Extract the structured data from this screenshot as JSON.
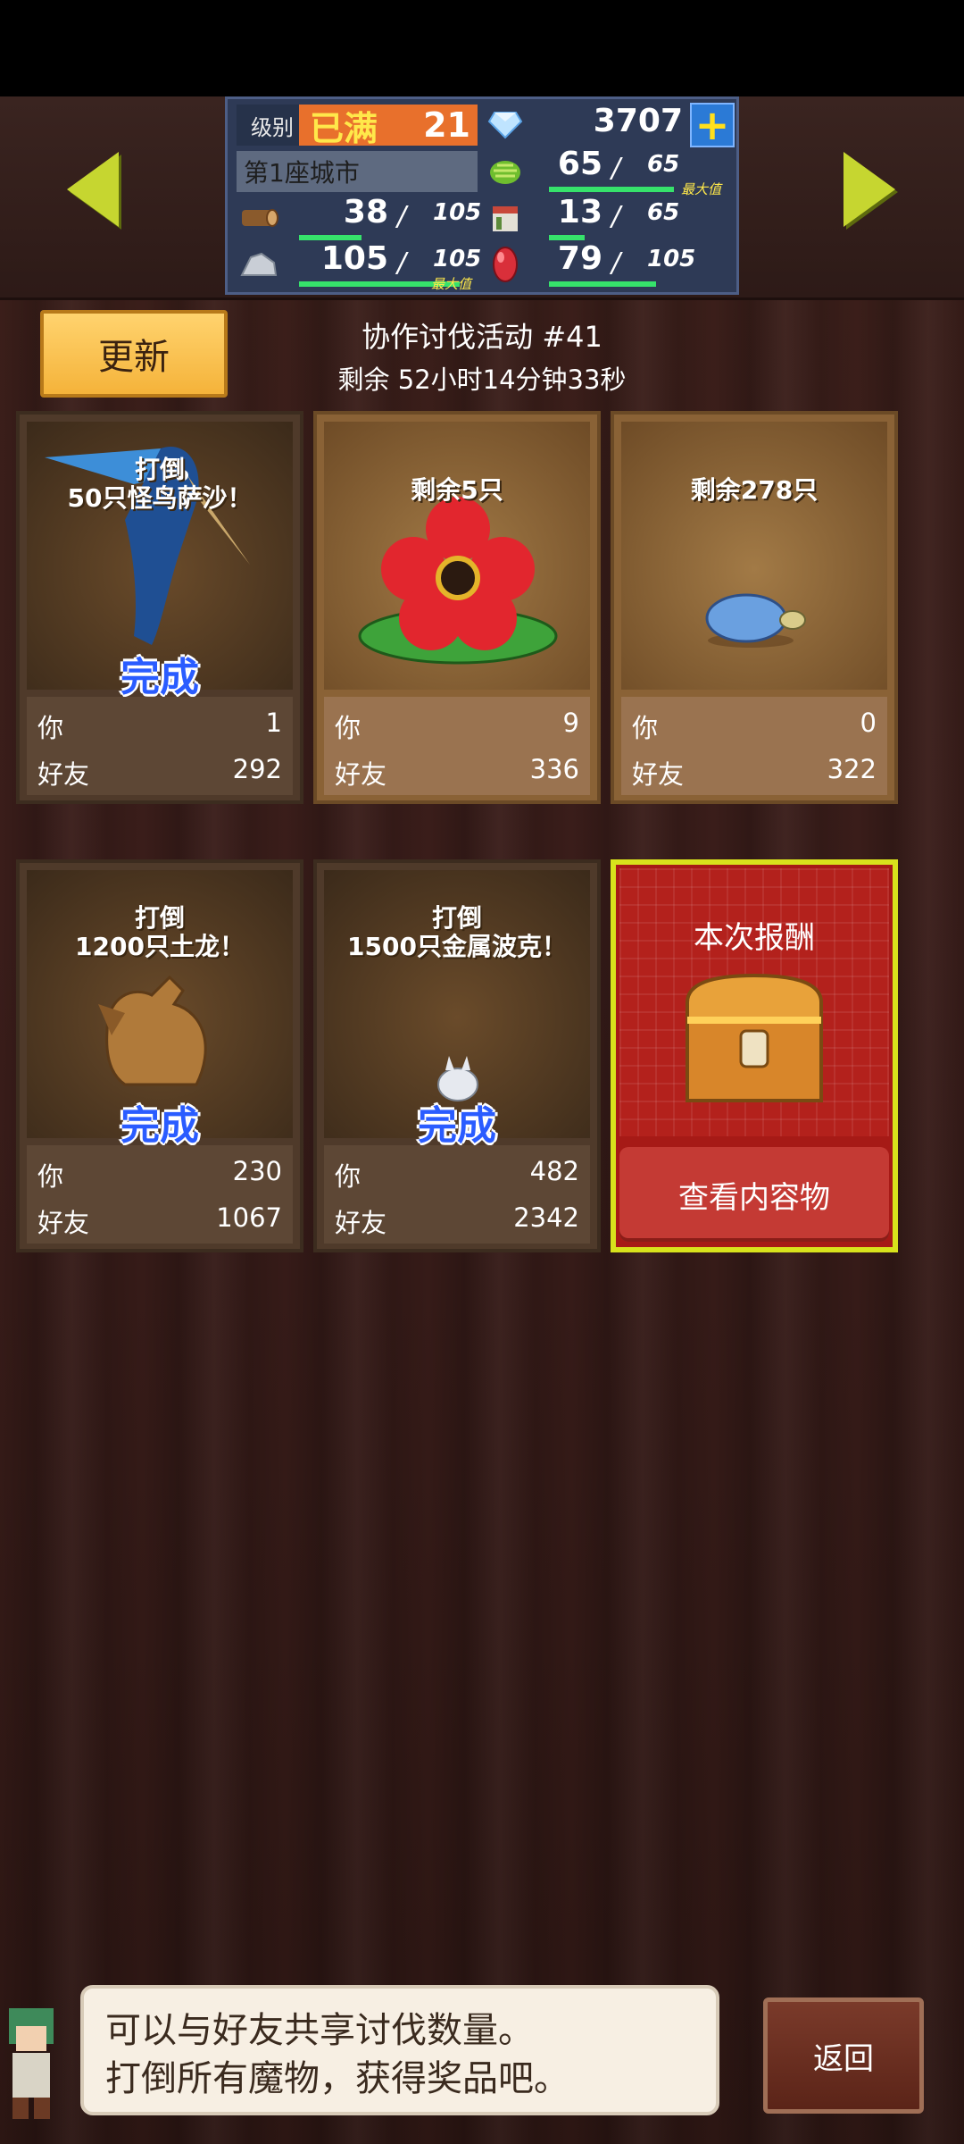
{
  "status_panel": {
    "level_label": "级别",
    "level_max_label": "已满",
    "level_value": "21",
    "gems": "3707",
    "plus_icon": "plus-icon",
    "city": "第1座城市",
    "food": {
      "value": "65",
      "max": "65",
      "tag": "最大值"
    },
    "wood": {
      "value": "38",
      "max": "105"
    },
    "fabric": {
      "value": "13",
      "max": "65"
    },
    "stone": {
      "value": "105",
      "max": "105",
      "tag": "最大值"
    },
    "ruby": {
      "value": "79",
      "max": "105"
    },
    "slash": "/"
  },
  "header": {
    "refresh_label": "更新",
    "event_title": "协作讨伐活动 #41",
    "timer": "剩余 52小时14分钟33秒"
  },
  "cards": [
    {
      "caption": "打倒\n50只怪鸟萨沙！",
      "status": "完成",
      "you_label": "你",
      "you": "1",
      "friends_label": "好友",
      "friends": "292"
    },
    {
      "caption": "剩余5只",
      "status": "",
      "you_label": "你",
      "you": "9",
      "friends_label": "好友",
      "friends": "336"
    },
    {
      "caption": "剩余278只",
      "status": "",
      "you_label": "你",
      "you": "0",
      "friends_label": "好友",
      "friends": "322"
    },
    {
      "caption": "打倒\n1200只土龙！",
      "status": "完成",
      "you_label": "你",
      "you": "230",
      "friends_label": "好友",
      "friends": "1067"
    },
    {
      "caption": "打倒\n1500只金属波克！",
      "status": "完成",
      "you_label": "你",
      "you": "482",
      "friends_label": "好友",
      "friends": "2342"
    }
  ],
  "reward": {
    "title": "本次报酬",
    "view_button": "查看内容物"
  },
  "dialog": {
    "line1": "可以与好友共享讨伐数量。",
    "line2": "打倒所有魔物，获得奖品吧。"
  },
  "back_label": "返回",
  "colors": {
    "accent_yellow": "#c6d630",
    "complete_blue": "#2a5cff",
    "reward_red": "#a61a16",
    "progress_green": "#36e26b"
  }
}
